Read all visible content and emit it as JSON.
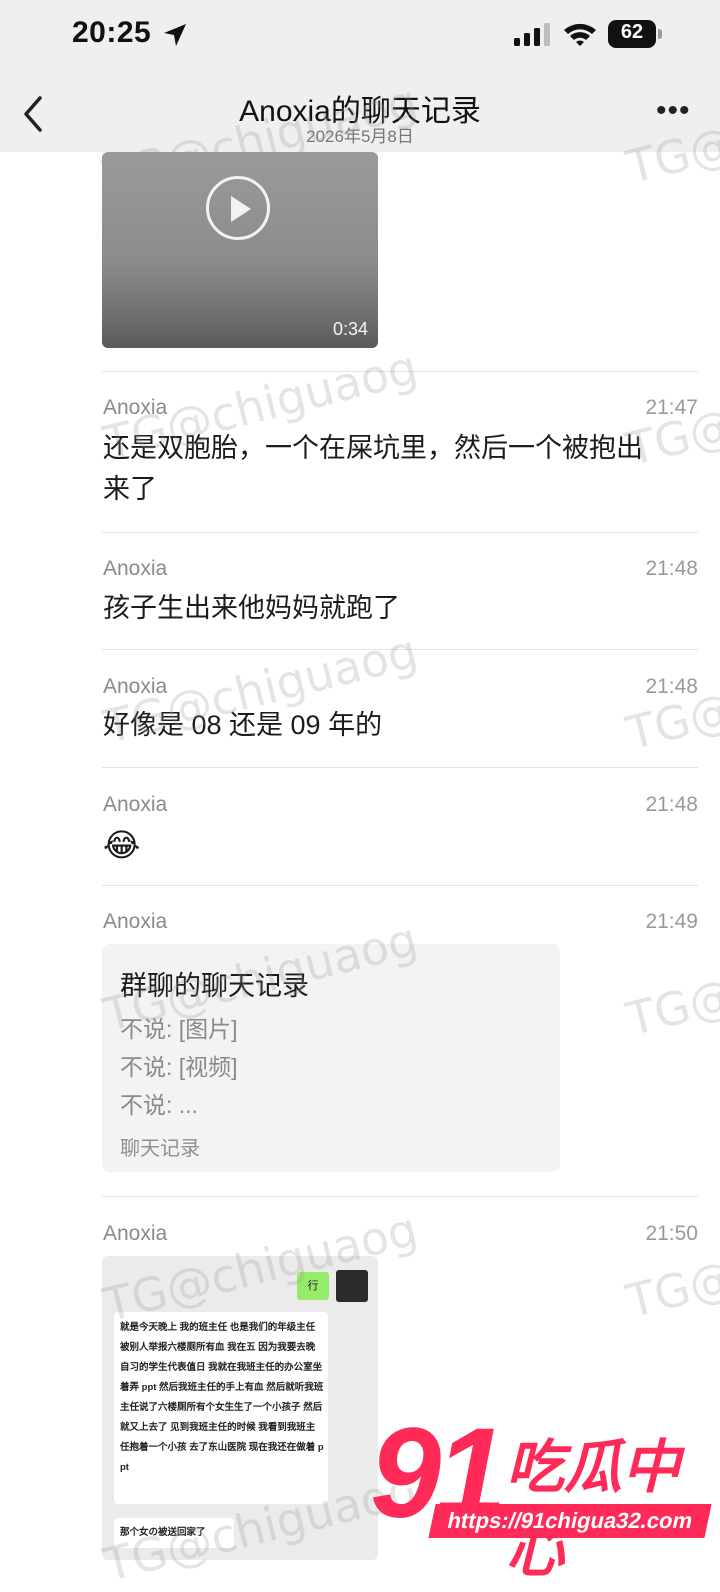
{
  "status_bar": {
    "time": "20:25",
    "battery": "62"
  },
  "nav": {
    "title": "Anoxia的聊天记录",
    "subtitle": "2026年5月8日",
    "more": "•••"
  },
  "video": {
    "duration": "0:34"
  },
  "messages": [
    {
      "sender": "Anoxia",
      "time": "21:47",
      "text_line1": "还是双胞胎，一个在屎坑里，然后一个被抱出",
      "text_line2": "来了"
    },
    {
      "sender": "Anoxia",
      "time": "21:48",
      "text": "孩子生出来他妈妈就跑了"
    },
    {
      "sender": "Anoxia",
      "time": "21:48",
      "text": "好像是 08 还是 09 年的"
    },
    {
      "sender": "Anoxia",
      "time": "21:48",
      "emoji": "😂"
    },
    {
      "sender": "Anoxia",
      "time": "21:49"
    },
    {
      "sender": "Anoxia",
      "time": "21:50"
    }
  ],
  "chat_record_card": {
    "title": "群聊的聊天记录",
    "lines": [
      "不说: [图片]",
      "不说: [视频]",
      "不说: ..."
    ],
    "footer": "聊天记录"
  },
  "screenshot": {
    "reply": "行",
    "text": "就是今天晚上 我的班主任 也是我们的年级主任 被别人举报六楼厕所有血 我在五 因为我要去晚自习的学生代表值日 我就在我班主任的办公室坐着弄 ppt 然后我班主任的手上有血 然后就听我班主任说了六楼厕所有个女生生了一个小孩子 然后就又上去了 见到我班主任的时候 我看到我班主任抱着一个小孩 去了东山医院 现在我还在做着 ppt",
    "text2": "那个女の被送回家了"
  },
  "watermark": {
    "text": "TG@chiguaog",
    "side_text": "TG@"
  },
  "logo": {
    "number": "91",
    "name": "吃瓜中心",
    "url": "https://91chigua32.com"
  },
  "colors": {
    "header_bg": "#efefef",
    "brand_pink": "#ff2a57",
    "wechat_green": "#95ec69"
  }
}
